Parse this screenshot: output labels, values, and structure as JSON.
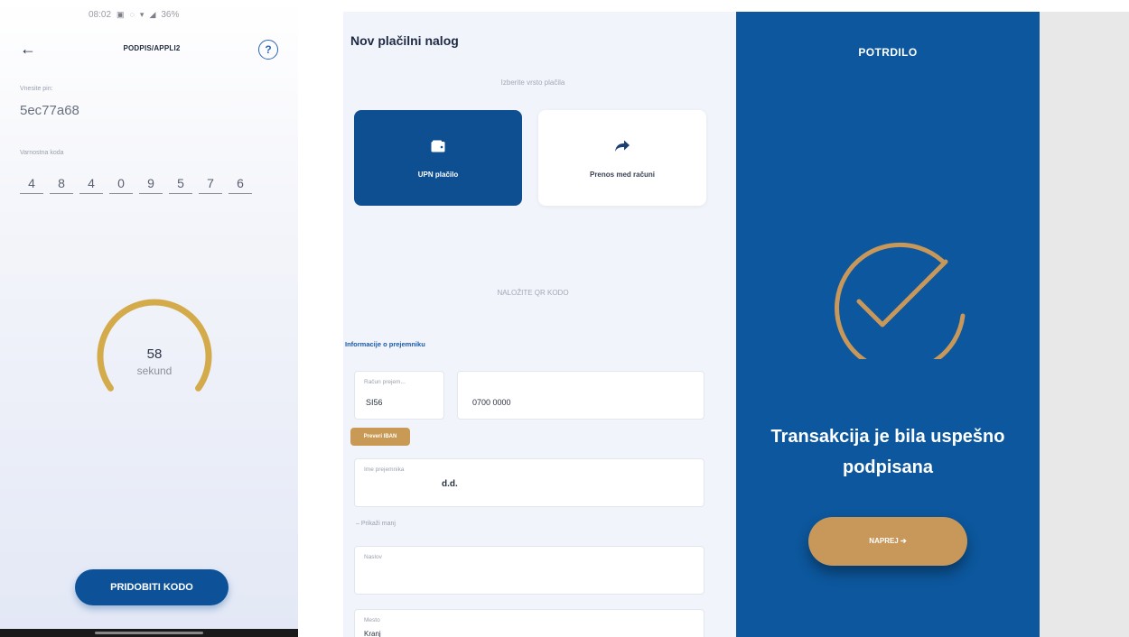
{
  "signing": {
    "status_bar": {
      "time": "08:02",
      "battery": "36%",
      "icons": [
        "image-icon",
        "notification-icon",
        "wifi-icon",
        "signal-icon"
      ]
    },
    "back_icon": "arrow-left-icon",
    "title": "PODPIS/APPLI2",
    "help_icon": "question-circle-icon",
    "hint_label": "Vnesite pin:",
    "hint_value": "5ec77a68",
    "code_label": "Varnostna koda",
    "code_digits": [
      "4",
      "8",
      "4",
      "0",
      "9",
      "5",
      "7",
      "6"
    ],
    "timer": {
      "value": "58",
      "unit": "sekund",
      "fraction_remaining": 0.7
    },
    "get_code_button": "PRIDOBITI KODO"
  },
  "payment": {
    "title": "Nov plačilni nalog",
    "choose_type_label": "Izberite vrsto plačila",
    "types": [
      {
        "label": "UPN plačilo",
        "icon": "wallet-icon",
        "active": true
      },
      {
        "label": "Prenos med računi",
        "icon": "share-arrow-icon",
        "active": false
      }
    ],
    "scan_qr_label": "NALOŽITE QR KODO",
    "recipient_section": "Informacije o prejemniku",
    "account_label": "Račun prejem...",
    "account_prefix": "SI56",
    "account_number": "0700 0000",
    "iban_button": "Preveri IBAN",
    "recipient_name_label": "Ime prejemnika",
    "recipient_name_value": "d.d.",
    "show_more": "Prikaži manj",
    "address_label": "Naslov",
    "city_label": "Mesto",
    "city_value": "Kranj"
  },
  "confirmation": {
    "title": "POTRDILO",
    "message": "Transakcija je bila uspešno podpisana",
    "next_button": "NAPREJ ➔",
    "colors": {
      "panel": "#0c579d",
      "gold": "#c8975a"
    }
  }
}
